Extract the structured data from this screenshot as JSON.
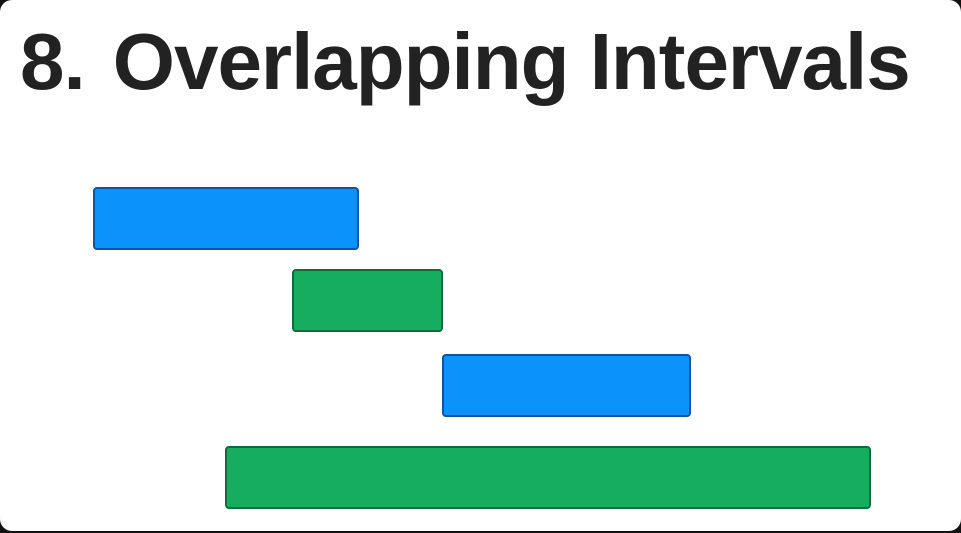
{
  "title": {
    "number": "8.",
    "text": "Overlapping Intervals"
  },
  "colors": {
    "blue_fill": "#0c93fb",
    "blue_border": "#0b55a6",
    "green_fill": "#17ad5e",
    "green_border": "#0e6b3b",
    "title_text": "#222222",
    "background": "#ffffff"
  },
  "intervals": [
    {
      "start": 93,
      "end": 359,
      "color": "blue"
    },
    {
      "start": 292,
      "end": 443,
      "color": "green"
    },
    {
      "start": 442,
      "end": 691,
      "color": "blue"
    },
    {
      "start": 225,
      "end": 871,
      "color": "green"
    }
  ]
}
